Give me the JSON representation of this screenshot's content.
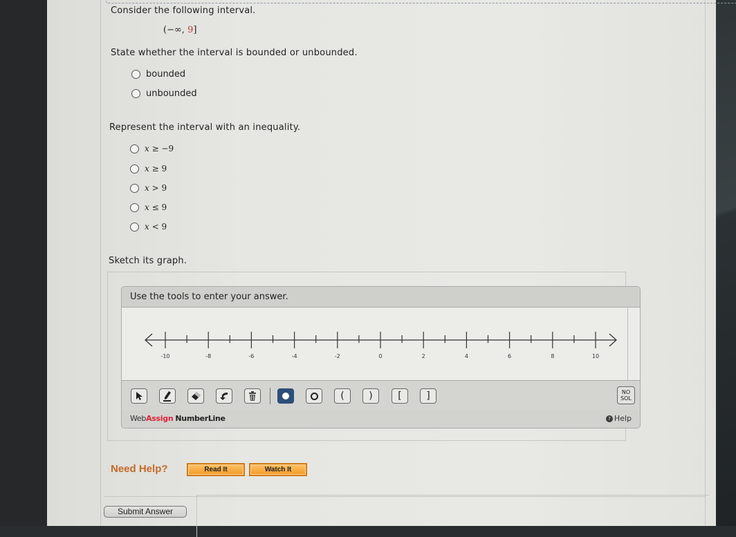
{
  "question": {
    "prompt": "Consider the following interval.",
    "interval": {
      "open": "(",
      "left": "−∞, ",
      "right_value": "9",
      "close": "]",
      "highlight_color": "#c0392b"
    }
  },
  "bounded_part": {
    "prompt": "State whether the interval is bounded or unbounded.",
    "options": [
      {
        "label": "bounded",
        "selected": false
      },
      {
        "label": "unbounded",
        "selected": false
      }
    ]
  },
  "inequality_part": {
    "prompt": "Represent the interval with an inequality.",
    "options": [
      {
        "var": "x",
        "op": "≥",
        "value": "−9",
        "selected": false
      },
      {
        "var": "x",
        "op": "≥",
        "value": "9",
        "selected": false
      },
      {
        "var": "x",
        "op": ">",
        "value": "9",
        "selected": false
      },
      {
        "var": "x",
        "op": "≤",
        "value": "9",
        "selected": false
      },
      {
        "var": "x",
        "op": "<",
        "value": "9",
        "selected": false
      }
    ]
  },
  "graph_part": {
    "prompt": "Sketch its graph.",
    "widget": {
      "instructions": "Use the tools to enter your answer.",
      "number_line": {
        "min": -10,
        "max": 10,
        "major_step": 2,
        "minor_step": 1,
        "tick_labels": [
          "-10",
          "-8",
          "-6",
          "-4",
          "-2",
          "0",
          "2",
          "4",
          "6",
          "8",
          "10"
        ]
      },
      "tools": [
        {
          "name": "pointer-tool",
          "icon": "cursor-arrow-icon",
          "active": false
        },
        {
          "name": "pencil-tool",
          "icon": "pencil-icon",
          "active": false
        },
        {
          "name": "eraser-tool",
          "icon": "eraser-icon",
          "active": false
        },
        {
          "name": "undo-tool",
          "icon": "undo-arrow-icon",
          "active": false
        },
        {
          "name": "trash-tool",
          "icon": "trash-icon",
          "active": false
        },
        {
          "name": "closed-point-tool",
          "icon": "filled-dot-icon",
          "active": true
        },
        {
          "name": "open-point-tool",
          "icon": "open-dot-icon",
          "glyph": "o",
          "active": false
        },
        {
          "name": "left-paren-tool",
          "icon": "left-paren-icon",
          "glyph": "(",
          "active": false
        },
        {
          "name": "right-paren-tool",
          "icon": "right-paren-icon",
          "glyph": ")",
          "active": false
        },
        {
          "name": "left-bracket-tool",
          "icon": "left-bracket-icon",
          "glyph": "[",
          "active": false
        },
        {
          "name": "right-bracket-tool",
          "icon": "right-bracket-icon",
          "glyph": "]",
          "active": false
        }
      ],
      "no_solution": {
        "line1": "NO",
        "line2": "SOL"
      },
      "brand": {
        "web": "Web",
        "assign": "Assign",
        "product": "NumberLine",
        "assign_color": "#e0243a"
      },
      "help_label": "Help"
    }
  },
  "need_help": {
    "label": "Need Help?",
    "buttons": [
      {
        "label": "Read It"
      },
      {
        "label": "Watch It"
      }
    ]
  },
  "submit": {
    "label": "Submit Answer"
  }
}
